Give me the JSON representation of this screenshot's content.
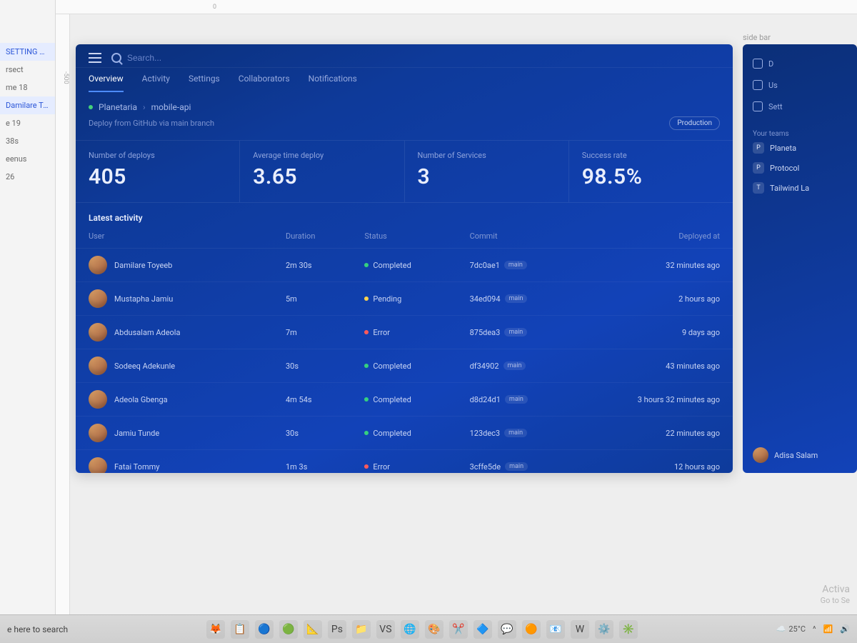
{
  "editor": {
    "layers": [
      "SETTING A...",
      "rsect",
      "me 18",
      "Damilare To...",
      "e 19",
      "38s",
      "eenus",
      "26"
    ],
    "search_hint": "e here to search",
    "canvas_label_side": "side bar",
    "ruler_h": "0",
    "ruler_v": "-500"
  },
  "dash": {
    "search_placeholder": "Search...",
    "tabs": [
      "Overview",
      "Activity",
      "Settings",
      "Collaborators",
      "Notifications"
    ],
    "breadcrumb": {
      "project": "Planetaria",
      "item": "mobile-api"
    },
    "subtitle": "Deploy from GitHub via main branch",
    "env_badge": "Production",
    "metrics": [
      {
        "label": "Number of deploys",
        "value": "405"
      },
      {
        "label": "Average time deploy",
        "value": "3.65"
      },
      {
        "label": "Number of Services",
        "value": "3"
      },
      {
        "label": "Success rate",
        "value": "98.5%"
      }
    ],
    "section_title": "Latest activity",
    "columns": {
      "user": "User",
      "duration": "Duration",
      "status": "Status",
      "commit": "Commit",
      "deployed": "Deployed at"
    },
    "rows": [
      {
        "user": "Damilare Toyeeb",
        "duration": "2m 30s",
        "status": "Completed",
        "status_type": "ok",
        "commit": "7dc0ae1",
        "chip": "main",
        "deployed": "32 minutes ago"
      },
      {
        "user": "Mustapha Jamiu",
        "duration": "5m",
        "status": "Pending",
        "status_type": "pend",
        "commit": "34ed094",
        "chip": "main",
        "deployed": "2 hours ago"
      },
      {
        "user": "Abdusalam Adeola",
        "duration": "7m",
        "status": "Error",
        "status_type": "err",
        "commit": "875dea3",
        "chip": "main",
        "deployed": "9 days ago"
      },
      {
        "user": "Sodeeq Adekunle",
        "duration": "30s",
        "status": "Completed",
        "status_type": "ok",
        "commit": "df34902",
        "chip": "main",
        "deployed": "43 minutes ago"
      },
      {
        "user": "Adeola Gbenga",
        "duration": "4m 54s",
        "status": "Completed",
        "status_type": "ok",
        "commit": "d8d24d1",
        "chip": "main",
        "deployed": "3 hours 32 minutes ago"
      },
      {
        "user": "Jamiu Tunde",
        "duration": "30s",
        "status": "Completed",
        "status_type": "ok",
        "commit": "123dec3",
        "chip": "main",
        "deployed": "22 minutes ago"
      },
      {
        "user": "Fatai Tommy",
        "duration": "1m 3s",
        "status": "Error",
        "status_type": "err",
        "commit": "3cffe5de",
        "chip": "main",
        "deployed": "12 hours ago"
      }
    ]
  },
  "side": {
    "frame_label": "side bar",
    "nav": [
      {
        "label": "D",
        "active": false
      },
      {
        "label": "Us",
        "active": false
      },
      {
        "label": "Sett",
        "active": false
      }
    ],
    "teams_label": "Your teams",
    "teams": [
      {
        "initial": "P",
        "name": "Planeta"
      },
      {
        "initial": "P",
        "name": "Protocol"
      },
      {
        "initial": "T",
        "name": "Tailwind La"
      }
    ],
    "profile_name": "Adisa Salam"
  },
  "watermark": {
    "l1": "Activa",
    "l2": "Go to Se"
  },
  "taskbar": {
    "temp": "25°C",
    "icons": [
      "🦊",
      "📋",
      "🔵",
      "🟢",
      "📐",
      "Ps",
      "📁",
      "VS",
      "🌐",
      "🎨",
      "✂️",
      "🔷",
      "💬",
      "🟠",
      "📧",
      "W",
      "⚙️",
      "✳️"
    ]
  }
}
